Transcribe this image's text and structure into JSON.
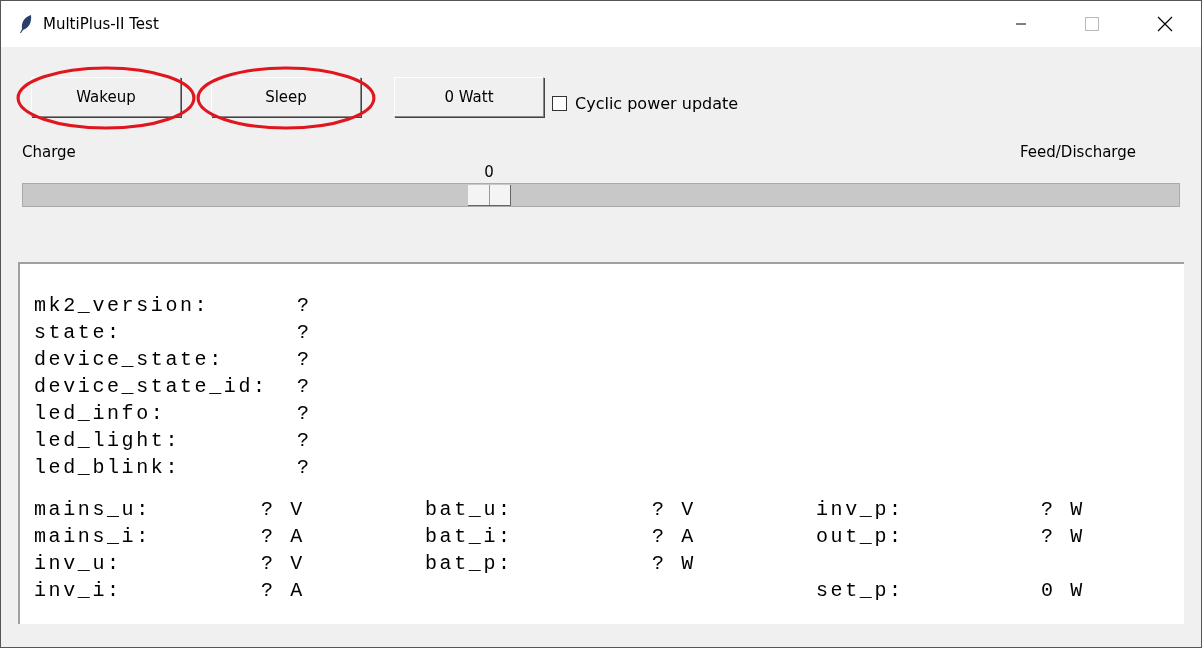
{
  "window": {
    "title": "MultiPlus-II Test"
  },
  "buttons": [
    {
      "label": "Wakeup",
      "circled": true
    },
    {
      "label": "Sleep",
      "circled": true
    },
    {
      "label": "0 Watt",
      "circled": false
    }
  ],
  "cyclic": {
    "label": "Cyclic power update",
    "checked": false
  },
  "slider": {
    "left_label": "Charge",
    "right_label": "Feed/Discharge",
    "reading": "0",
    "level": 0.4
  },
  "info": [
    {
      "label": "mk2_version:",
      "value": "?"
    },
    {
      "label": "state:",
      "value": "?"
    },
    {
      "label": "device_state:",
      "value": "?"
    },
    {
      "label": "device_state_id:",
      "value": "?"
    },
    {
      "label": "led_info:",
      "value": "?"
    },
    {
      "label": "led_light:",
      "value": "?"
    },
    {
      "label": "led_blink:",
      "value": "?"
    }
  ],
  "measures": [
    [
      {
        "label": "mains_u:",
        "value": "? V",
        "kind": "reading"
      },
      {
        "label": "mains_i:",
        "value": "? A",
        "kind": "reading"
      },
      {
        "label": "inv_u:",
        "value": "? V",
        "kind": "reading"
      },
      {
        "label": "inv_i:",
        "value": "? A",
        "kind": "reading"
      }
    ],
    [
      {
        "label": "bat_u:",
        "value": "? V",
        "kind": "reading"
      },
      {
        "label": "bat_i:",
        "value": "? A",
        "kind": "reading"
      },
      {
        "label": "bat_p:",
        "value": "? W",
        "kind": "reading"
      }
    ],
    [
      {
        "label": "inv_p:",
        "value": "? W",
        "kind": "reading"
      },
      {
        "label": "out_p:",
        "value": "? W",
        "kind": "reading"
      },
      {
        "label": "set_p:",
        "value": "0 W",
        "kind": "setpoint"
      }
    ]
  ]
}
